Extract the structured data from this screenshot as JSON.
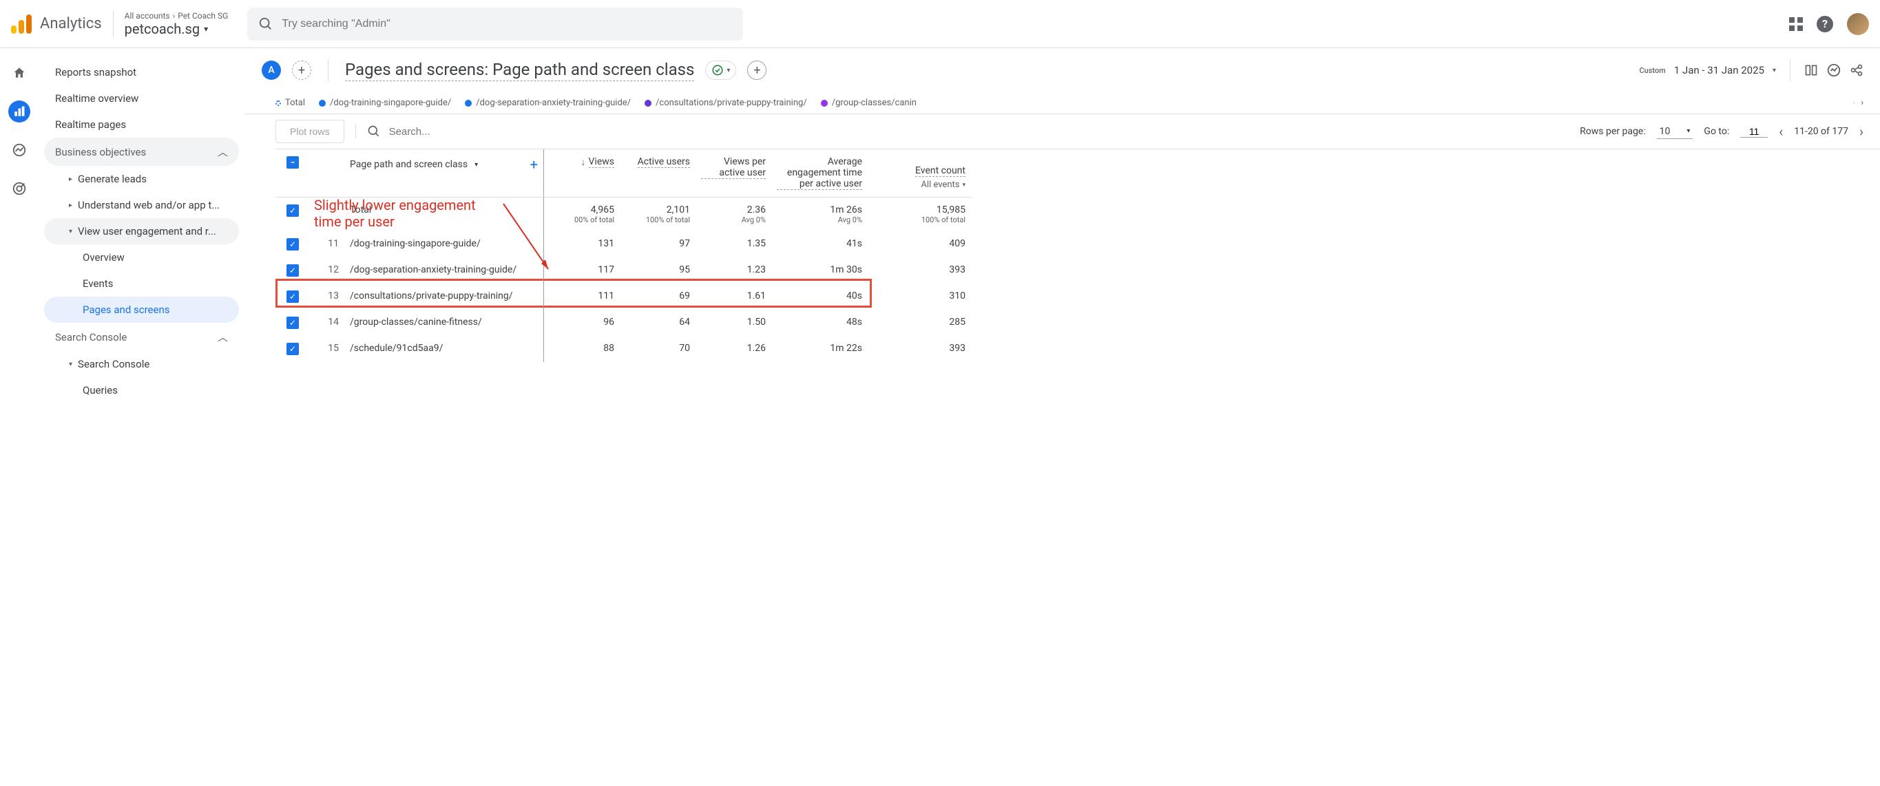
{
  "header": {
    "logo_text": "Analytics",
    "breadcrumb_all": "All accounts",
    "breadcrumb_account": "Pet Coach SG",
    "property": "petcoach.sg",
    "search_placeholder": "Try searching \"Admin\""
  },
  "sidebar": {
    "snapshot": "Reports snapshot",
    "realtime_overview": "Realtime overview",
    "realtime_pages": "Realtime pages",
    "business_objectives": "Business objectives",
    "generate_leads": "Generate leads",
    "understand_web": "Understand web and/or app t...",
    "view_engagement": "View user engagement and r...",
    "overview": "Overview",
    "events": "Events",
    "pages_screens": "Pages and screens",
    "search_console_section": "Search Console",
    "search_console": "Search Console",
    "queries": "Queries"
  },
  "report": {
    "badge": "A",
    "title": "Pages and screens: Page path and screen class",
    "custom_label": "Custom",
    "date_range": "1 Jan - 31 Jan 2025"
  },
  "legend": {
    "total": "Total",
    "items": [
      {
        "color": "#1a73e8",
        "label": "/dog-training-singapore-guide/"
      },
      {
        "color": "#1a73e8",
        "label": "/dog-separation-anxiety-training-guide/"
      },
      {
        "color": "#6139d6",
        "label": "/consultations/private-puppy-training/"
      },
      {
        "color": "#9334e6",
        "label": "/group-classes/canin"
      }
    ]
  },
  "toolbar": {
    "plot_rows": "Plot rows",
    "search_placeholder": "Search...",
    "rpp_label": "Rows per page:",
    "rpp_value": "10",
    "goto_label": "Go to:",
    "goto_value": "11",
    "page_info": "11-20 of 177"
  },
  "table": {
    "dimension": "Page path and screen class",
    "columns": {
      "views": "Views",
      "active_users": "Active users",
      "views_per_user": "Views per active user",
      "avg_engagement": "Average engagement time per active user",
      "event_count": "Event count",
      "event_sub": "All events"
    },
    "total": {
      "label": "Total",
      "views": "4,965",
      "views_sub": "00% of total",
      "active_users": "2,101",
      "active_users_sub": "100% of total",
      "vpu": "2.36",
      "vpu_sub": "Avg 0%",
      "aet": "1m 26s",
      "aet_sub": "Avg 0%",
      "events": "15,985",
      "events_sub": "100% of total"
    },
    "rows": [
      {
        "idx": "11",
        "path": "/dog-training-singapore-guide/",
        "views": "131",
        "au": "97",
        "vpu": "1.35",
        "aet": "41s",
        "ec": "409"
      },
      {
        "idx": "12",
        "path": "/dog-separation-anxiety-training-guide/",
        "views": "117",
        "au": "95",
        "vpu": "1.23",
        "aet": "1m 30s",
        "ec": "393"
      },
      {
        "idx": "13",
        "path": "/consultations/private-puppy-training/",
        "views": "111",
        "au": "69",
        "vpu": "1.61",
        "aet": "40s",
        "ec": "310"
      },
      {
        "idx": "14",
        "path": "/group-classes/canine-fitness/",
        "views": "96",
        "au": "64",
        "vpu": "1.50",
        "aet": "48s",
        "ec": "285"
      },
      {
        "idx": "15",
        "path": "/schedule/91cd5aa9/",
        "views": "88",
        "au": "70",
        "vpu": "1.26",
        "aet": "1m 22s",
        "ec": "393"
      }
    ]
  },
  "annotation": {
    "line1": "Slightly lower engagement",
    "line2": "time per user"
  }
}
